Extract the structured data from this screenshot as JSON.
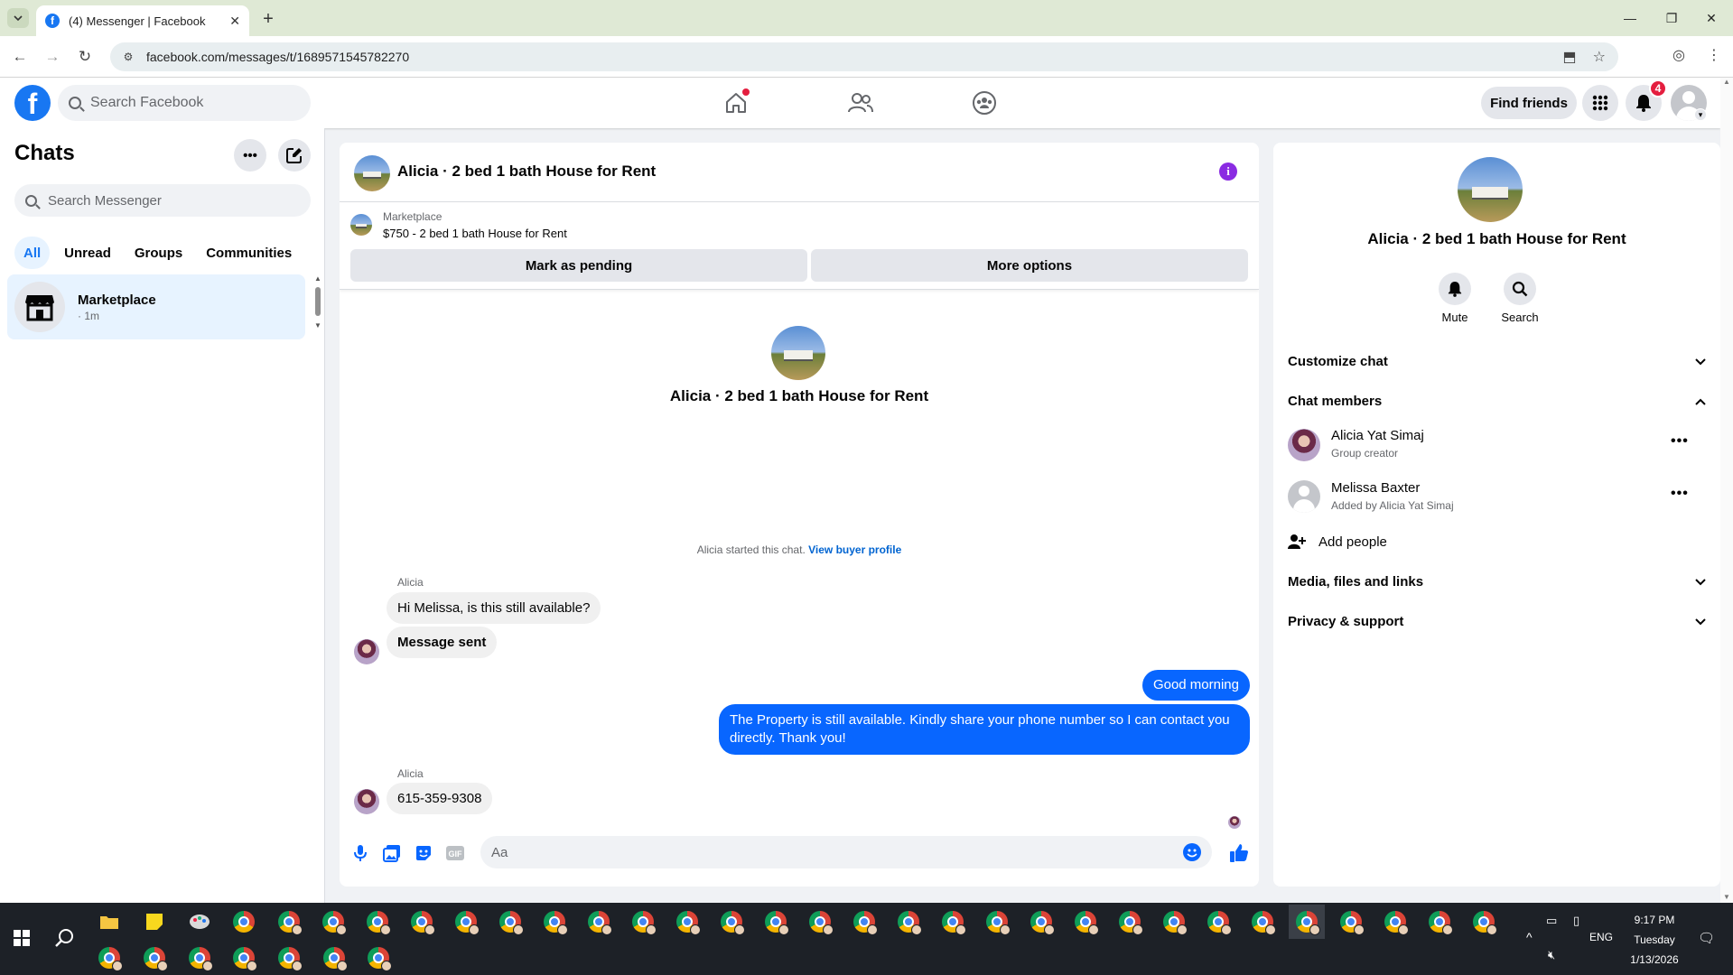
{
  "browser": {
    "tab_title": "(4) Messenger | Facebook",
    "url": "facebook.com/messages/t/1689571545782270"
  },
  "fb_nav": {
    "search_placeholder": "Search Facebook",
    "find_friends": "Find friends",
    "notification_count": "4"
  },
  "chats": {
    "title": "Chats",
    "search_placeholder": "Search Messenger",
    "filters": [
      "All",
      "Unread",
      "Groups",
      "Communities"
    ],
    "active_filter": "All",
    "items": [
      {
        "name": "Marketplace",
        "meta": "· 1m"
      }
    ]
  },
  "conversation": {
    "title": "Alicia · 2 bed 1 bath House for Rent",
    "marketplace_label": "Marketplace",
    "listing": "$750 - 2 bed 1 bath House for Rent",
    "mark_pending": "Mark as pending",
    "more_options": "More options",
    "intro_name": "Alicia · 2 bed 1 bath House for Rent",
    "started_text": "Alicia started this chat.",
    "view_buyer_profile": "View buyer profile",
    "messages": [
      {
        "sender": "Alicia",
        "text": "Hi Melissa, is this still available?"
      },
      {
        "text": "Message sent"
      },
      {
        "text": "Good morning"
      },
      {
        "text": "The Property is still available. Kindly share your phone number so I can contact you directly. Thank you!"
      },
      {
        "sender": "Alicia",
        "text": "615-359-9308"
      }
    ],
    "input_placeholder": "Aa"
  },
  "info_panel": {
    "name": "Alicia · 2 bed 1 bath House for Rent",
    "actions": [
      "Mute",
      "Search"
    ],
    "customize_chat": "Customize chat",
    "chat_members": "Chat members",
    "members": [
      {
        "name": "Alicia Yat Simaj",
        "sub": "Group creator"
      },
      {
        "name": "Melissa Baxter",
        "sub": "Added by Alicia Yat Simaj"
      }
    ],
    "add_people": "Add people",
    "media": "Media, files and links",
    "privacy": "Privacy & support"
  },
  "taskbar": {
    "time": "9:17 PM",
    "day": "Tuesday",
    "date": "1/13/2026",
    "lang": "ENG"
  },
  "colors": {
    "fb_blue": "#1877f2",
    "message_blue": "#0866ff",
    "notification_red": "#e41e3f"
  }
}
